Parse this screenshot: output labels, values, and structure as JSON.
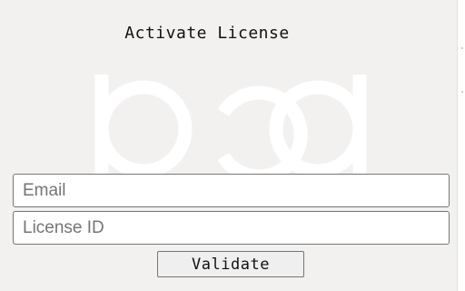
{
  "dialog": {
    "title": "Activate License",
    "logo_icon": "bd-logo-watermark"
  },
  "form": {
    "email_placeholder": "Email",
    "email_value": "",
    "license_placeholder": "License ID",
    "license_value": "",
    "validate_label": "Validate"
  },
  "colors": {
    "background": "#f3f1f0",
    "watermark": "#ffffff",
    "field_border": "#767676",
    "button_background": "#efefef"
  }
}
